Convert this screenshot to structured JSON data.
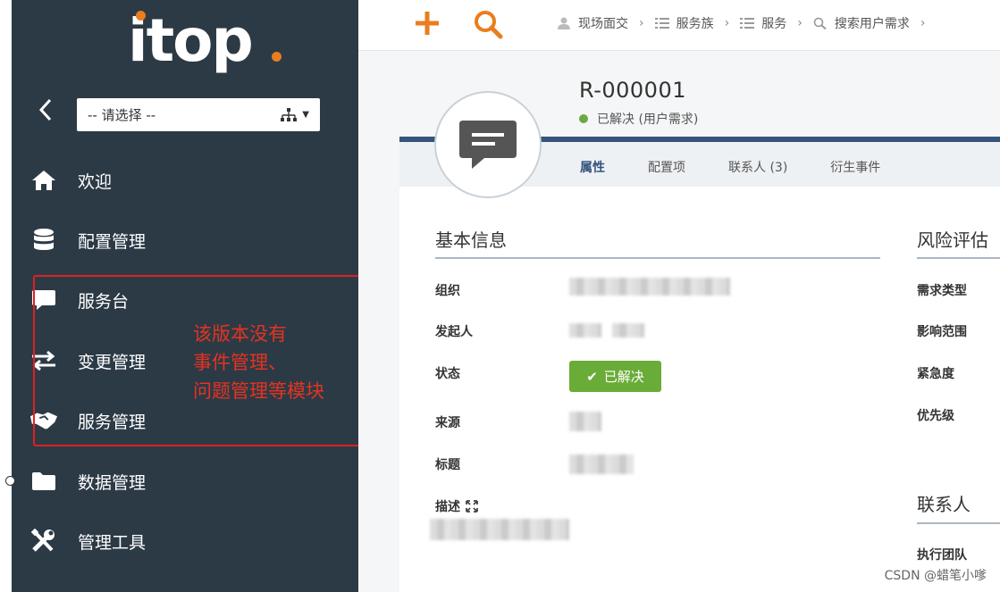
{
  "logo": {
    "text": "itop"
  },
  "sidebar": {
    "org_select": {
      "value": "-- 请选择 --"
    },
    "items": [
      {
        "label": "欢迎",
        "icon": "home-icon"
      },
      {
        "label": "配置管理",
        "icon": "database-icon"
      },
      {
        "label": "服务台",
        "icon": "comment-icon"
      },
      {
        "label": "变更管理",
        "icon": "exchange-icon"
      },
      {
        "label": "服务管理",
        "icon": "handshake-icon"
      },
      {
        "label": "数据管理",
        "icon": "folder-icon"
      },
      {
        "label": "管理工具",
        "icon": "tools-icon"
      }
    ],
    "annotation": [
      "该版本没有",
      "事件管理、",
      "问题管理等模块"
    ]
  },
  "topbar": {
    "breadcrumbs": [
      {
        "label": "现场面交",
        "icon": "user-icon"
      },
      {
        "label": "服务族",
        "icon": "list-icon"
      },
      {
        "label": "服务",
        "icon": "list-icon"
      },
      {
        "label": "搜索用户需求",
        "icon": "search-icon"
      }
    ]
  },
  "object": {
    "ref": "R-000001",
    "status_text": "已解决 (用户需求)",
    "tabs": [
      "属性",
      "配置项",
      "联系人 (3)",
      "衍生事件"
    ]
  },
  "basic_info": {
    "title": "基本信息",
    "fields": {
      "org": "组织",
      "caller": "发起人",
      "status": "状态",
      "origin": "来源",
      "title": "标题",
      "description": "描述"
    },
    "status_badge": "已解决"
  },
  "risk": {
    "title": "风险评估",
    "fields": [
      "需求类型",
      "影响范围",
      "紧急度",
      "优先级"
    ]
  },
  "contacts": {
    "title": "联系人",
    "fields": [
      "执行团队"
    ]
  },
  "watermark": "CSDN @蜡笔小嗲",
  "colors": {
    "sidebar_bg": "#2c3a46",
    "accent": "#ea7d1e",
    "header_blue": "#34547c",
    "status_green": "#6aac38",
    "annotation_red": "#e53320"
  }
}
